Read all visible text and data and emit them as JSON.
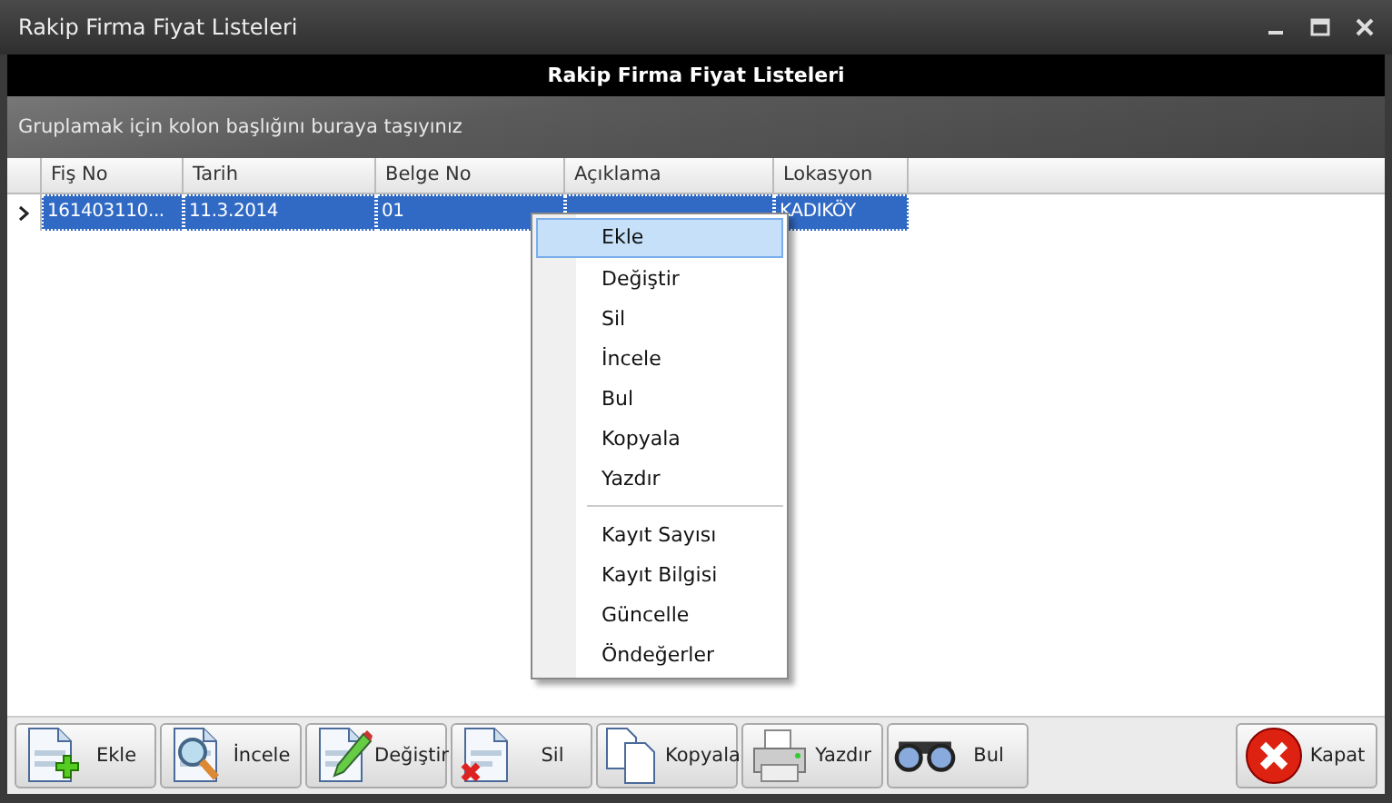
{
  "window": {
    "title": "Rakip Firma Fiyat Listeleri"
  },
  "header": {
    "title": "Rakip Firma Fiyat Listeleri"
  },
  "group_panel": {
    "hint": "Gruplamak için kolon başlığını buraya taşıyınız"
  },
  "table": {
    "columns": [
      "Fiş No",
      "Tarih",
      "Belge No",
      "Açıklama",
      "Lokasyon"
    ],
    "rows": [
      {
        "cells": [
          "161403110...",
          "11.3.2014",
          "01",
          "",
          "KADIKÖY"
        ],
        "selected": true
      }
    ]
  },
  "context_menu": {
    "groups": [
      [
        {
          "label": "Ekle",
          "selected": true
        },
        {
          "label": "Değiştir",
          "selected": false
        },
        {
          "label": "Sil",
          "selected": false
        },
        {
          "label": "İncele",
          "selected": false
        },
        {
          "label": "Bul",
          "selected": false
        },
        {
          "label": "Kopyala",
          "selected": false
        },
        {
          "label": "Yazdır",
          "selected": false
        }
      ],
      [
        {
          "label": "Kayıt Sayısı",
          "selected": false
        },
        {
          "label": "Kayıt Bilgisi",
          "selected": false
        },
        {
          "label": "Güncelle",
          "selected": false
        },
        {
          "label": "Öndeğerler",
          "selected": false
        }
      ]
    ]
  },
  "buttons": [
    {
      "label": "Ekle",
      "kind": "add"
    },
    {
      "label": "İncele",
      "kind": "inspect"
    },
    {
      "label": "Değiştir",
      "kind": "edit"
    },
    {
      "label": "Sil",
      "kind": "delete"
    },
    {
      "label": "Kopyala",
      "kind": "copy"
    },
    {
      "label": "Yazdır",
      "kind": "print"
    },
    {
      "label": "Bul",
      "kind": "find"
    }
  ],
  "close_button": {
    "label": "Kapat"
  }
}
